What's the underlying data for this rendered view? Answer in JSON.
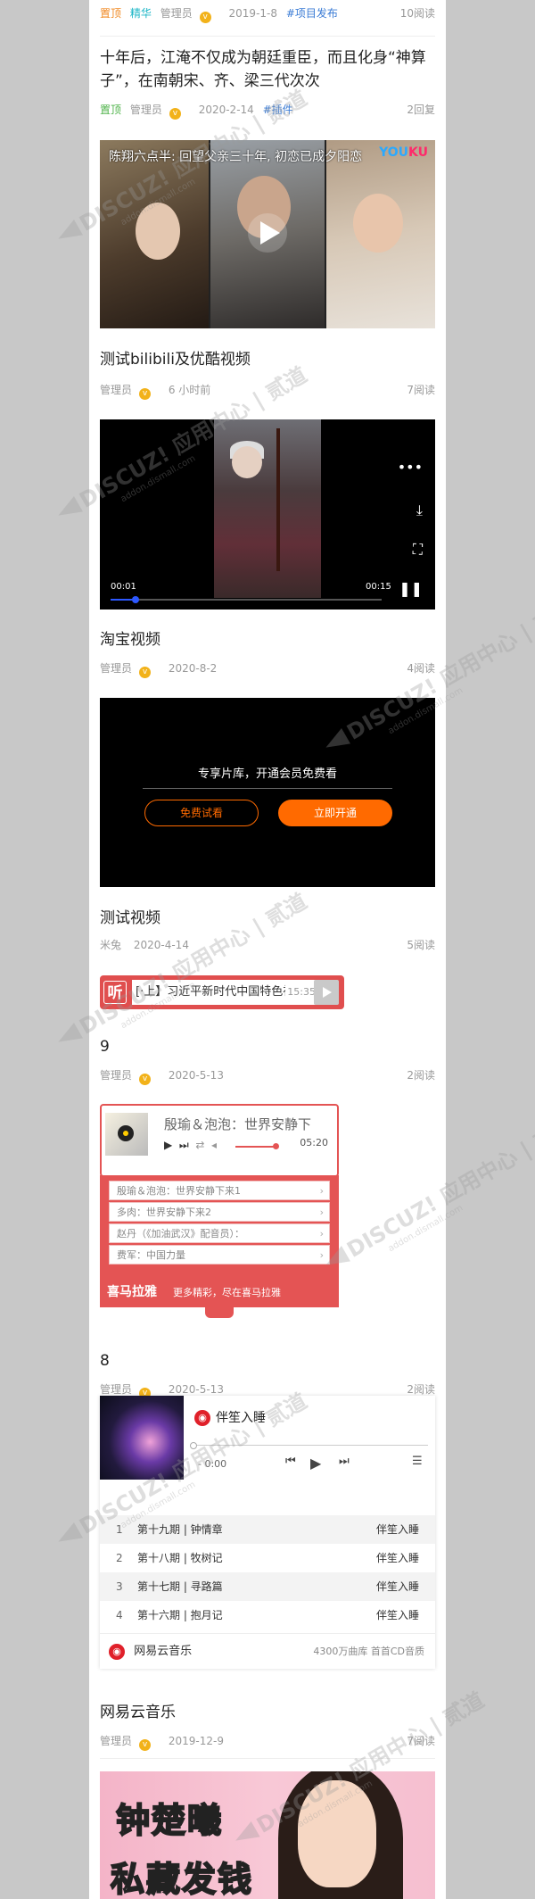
{
  "posts": [
    {
      "tags": [
        "置顶",
        "精华"
      ],
      "author": "管理员",
      "date": "2019-1-8",
      "topic": "#项目发布",
      "stat": "10阅读"
    },
    {
      "title": "十年后，江淹不仅成为朝廷重臣，而且化身“神算子”，在南朝宋、齐、梁三代次次",
      "tag": "置顶",
      "author": "管理员",
      "date": "2020-2-14",
      "topic": "#插件",
      "stat": "2回复",
      "video_overlay": "陈翔六点半: 回望父亲三十年, 初恋已成夕阳恋",
      "video_brand": "YOUKU"
    },
    {
      "title": "测试bilibili及优酷视频",
      "author": "管理员",
      "date": "6 小时前",
      "stat": "7阅读",
      "player": {
        "current": "00:01",
        "total": "00:15"
      }
    },
    {
      "title": "淘宝视频",
      "author": "管理员",
      "date": "2020-8-2",
      "stat": "4阅读",
      "vip_message": "专享片库，开通会员免费看",
      "trial_label": "免费试看",
      "open_label": "立即开通"
    },
    {
      "title": "测试视频",
      "author": "米兔",
      "date": "2020-4-14",
      "stat": "5阅读",
      "ting": {
        "logo": "听",
        "text": "[·上】习近平新时代中国特色社会主义思想",
        "time": "15:35"
      }
    },
    {
      "title": "9",
      "author": "管理员",
      "date": "2020-5-13",
      "stat": "2阅读",
      "xmly": {
        "song": "殷瑜＆泡泡：世界安静下",
        "duration": "05:20",
        "items": [
          "殷瑜＆泡泡：世界安静下来1",
          "多肉：世界安静下来2",
          "赵丹（《加油武汉》配音员）：",
          "费军：中国力量"
        ],
        "brand": "喜马拉雅",
        "slogan": "更多精彩，尽在喜马拉雅"
      }
    },
    {
      "title": "8",
      "author": "管理员",
      "date": "2020-5-13",
      "stat": "2阅读",
      "netease": {
        "album": "伴笙入睡",
        "current": "- 0:00",
        "tracks": [
          {
            "no": "1",
            "name": "第十九期 | 钟情章",
            "artist": "伴笙入睡"
          },
          {
            "no": "2",
            "name": "第十八期 | 牧树记",
            "artist": "伴笙入睡"
          },
          {
            "no": "3",
            "name": "第十七期 | 寻路篇",
            "artist": "伴笙入睡"
          },
          {
            "no": "4",
            "name": "第十六期 | 抱月记",
            "artist": "伴笙入睡"
          }
        ],
        "brand": "网易云音乐",
        "info": "4300万曲库 首首CD音质"
      }
    },
    {
      "title": "网易云音乐",
      "author": "管理员",
      "date": "2019-12-9",
      "stat": "7阅读",
      "image_text_1": "钟楚曦",
      "image_text_2": "私藏发钱"
    }
  ],
  "watermark": {
    "brand": "DISCUZ! 应用中心 | 贰道",
    "sub": "addon.dismall.com"
  }
}
